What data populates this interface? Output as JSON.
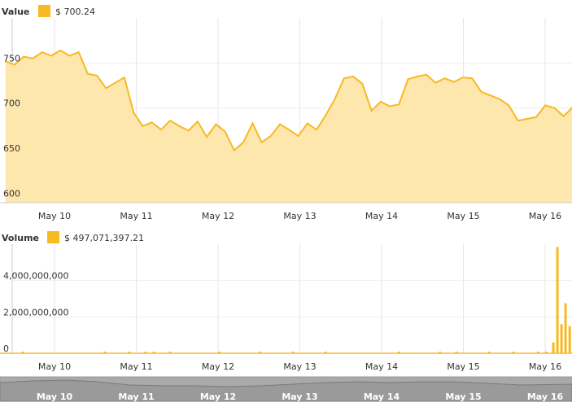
{
  "colors": {
    "accent": "#f7b924",
    "fill": "#fde7ad",
    "grid": "#e6e6e6",
    "navigator": "#a9a9a9"
  },
  "value_panel": {
    "label": "Value",
    "value": "$ 700.24"
  },
  "volume_panel": {
    "label": "Volume",
    "value": "$ 497,071,397.21"
  },
  "chart_data": [
    {
      "type": "area",
      "ylabel": "",
      "ylim": [
        595,
        800
      ],
      "y_ticks": [
        "600",
        "650",
        "700",
        "750"
      ],
      "x_labels": [
        "May 10",
        "May 11",
        "May 12",
        "May 13",
        "May 14",
        "May 15",
        "May 16"
      ],
      "x": [
        9.0,
        9.1,
        9.2,
        9.3,
        9.4,
        9.5,
        9.6,
        9.7,
        9.8,
        9.9,
        10.0,
        10.1,
        10.2,
        10.3,
        10.4,
        10.5,
        10.6,
        10.7,
        10.8,
        10.9,
        11.0,
        11.1,
        11.2,
        11.3,
        11.4,
        11.5,
        11.6,
        11.7,
        11.8,
        11.9,
        12.0,
        12.1,
        12.2,
        12.3,
        12.4,
        12.5,
        12.6,
        12.7,
        12.8,
        12.9,
        13.0,
        13.1,
        13.2,
        13.3,
        13.4,
        13.5,
        13.6,
        13.7,
        13.8,
        13.9,
        14.0,
        14.1,
        14.2,
        14.3,
        14.4,
        14.5,
        14.6,
        14.7,
        14.8,
        14.9,
        15.0,
        15.1,
        15.2,
        15.3,
        15.4,
        15.5,
        15.6,
        15.7,
        15.8,
        15.9,
        16.0,
        16.1,
        16.2,
        16.3,
        16.4
      ],
      "values": [
        752,
        748,
        757,
        755,
        762,
        758,
        764,
        758,
        762,
        738,
        736,
        722,
        728,
        734,
        695,
        680,
        684,
        676,
        686,
        680,
        675,
        685,
        668,
        682,
        674,
        653,
        662,
        683,
        662,
        669,
        682,
        676,
        669,
        683,
        676,
        692,
        710,
        733,
        735,
        727,
        697,
        707,
        702,
        704,
        732,
        735,
        737,
        728,
        733,
        729,
        734,
        733,
        718,
        714,
        710,
        703,
        686,
        688,
        690,
        703,
        700,
        691,
        701,
        700
      ],
      "values_note": "",
      "series_name": ""
    },
    {
      "type": "bar",
      "ylim": [
        0,
        6000000000
      ],
      "y_ticks": [
        "0",
        "2,000,000,000",
        "4,000,000,000"
      ],
      "x_labels": [
        "May 10",
        "May 11",
        "May 12",
        "May 13",
        "May 14",
        "May 15",
        "May 16"
      ],
      "x": [
        16.1,
        16.15,
        16.2,
        16.25,
        16.3,
        16.35
      ],
      "values": [
        600000000,
        5850000000,
        1600000000,
        2750000000,
        1500000000,
        500000000
      ]
    }
  ],
  "navigator": {
    "labels": [
      "May 10",
      "May 11",
      "May 12",
      "May 13",
      "May 14",
      "May 15",
      "May 16"
    ]
  }
}
